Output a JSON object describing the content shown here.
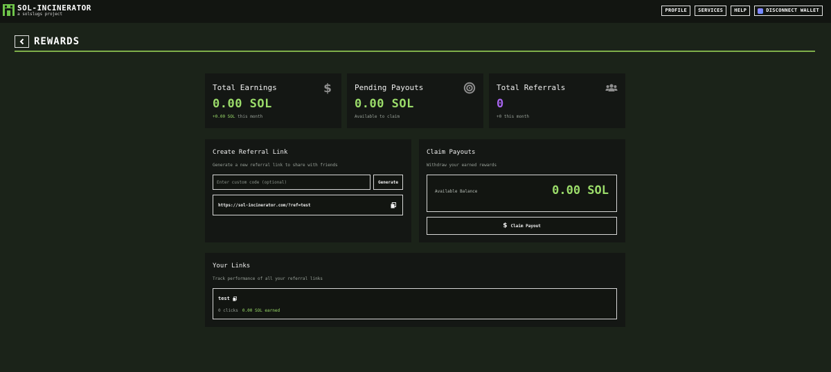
{
  "brand": {
    "title": "SOL-INCINERATOR",
    "subtitle": "a solslugs project"
  },
  "nav": {
    "profile": "PROFILE",
    "services": "SERVICES",
    "help": "HELP",
    "wallet": "DISCONNECT WALLET"
  },
  "page": {
    "title": "REWARDS"
  },
  "stats": {
    "earnings": {
      "title": "Total Earnings",
      "value": "0.00 SOL",
      "delta": "+0.00 SOL",
      "delta_suffix": "this month",
      "icon": "dollar-icon"
    },
    "pending": {
      "title": "Pending Payouts",
      "value": "0.00 SOL",
      "sub": "Available to claim",
      "icon": "target-icon"
    },
    "referrals": {
      "title": "Total Referrals",
      "value": "0",
      "sub": "+0 this month",
      "icon": "users-icon"
    }
  },
  "create_link": {
    "title": "Create Referral Link",
    "description": "Generate a new referral link to share with friends",
    "input_placeholder": "Enter custom code (optional)",
    "generate_label": "Generate",
    "link_url": "https://sol-incinerator.com/?ref=test"
  },
  "claim": {
    "title": "Claim Payouts",
    "description": "Withdraw your earned rewards",
    "balance_label": "Available Balance",
    "balance_value": "0.00 SOL",
    "button_label": "Claim Payout"
  },
  "your_links": {
    "title": "Your Links",
    "description": "Track performance of all your referral links",
    "items": [
      {
        "name": "test",
        "clicks": "0 clicks",
        "earned": "0.00 SOL earned"
      }
    ]
  },
  "colors": {
    "accent_green": "#9bdc6a",
    "accent_purple": "#a764ee",
    "rule_green": "#7fb04a",
    "background": "#1b2319",
    "card": "#141714"
  }
}
